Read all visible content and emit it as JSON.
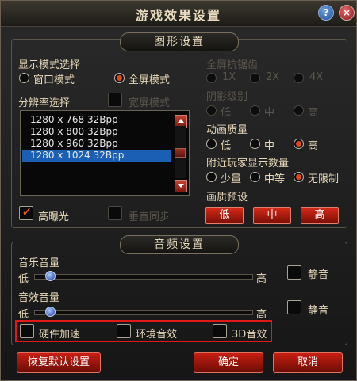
{
  "window": {
    "title": "游戏效果设置",
    "help_symbol": "?",
    "close_symbol": "×"
  },
  "graphics": {
    "header": "图形设置",
    "display_mode": {
      "label": "显示模式选择",
      "options": [
        "窗口模式",
        "全屏模式"
      ],
      "selected": "全屏模式"
    },
    "resolution": {
      "label": "分辨率选择",
      "widescreen_label": "宽屏模式",
      "items": [
        "1280 x 768 32Bpp",
        "1280 x 800 32Bpp",
        "1280 x 960 32Bpp",
        "1280 x 1024 32Bpp"
      ],
      "selected": "1280 x 1024 32Bpp"
    },
    "bloom_label": "高曝光",
    "vsync_label": "垂直同步",
    "antialias": {
      "label": "全屏抗锯齿",
      "options": [
        "1X",
        "2X",
        "4X"
      ]
    },
    "shadow": {
      "label": "阴影级别",
      "options": [
        "低",
        "中",
        "高"
      ]
    },
    "animation": {
      "label": "动画质量",
      "options": [
        "低",
        "中",
        "高"
      ],
      "selected": "高"
    },
    "players": {
      "label": "附近玩家显示数量",
      "options": [
        "少量",
        "中等",
        "无限制"
      ],
      "selected": "无限制"
    },
    "preset": {
      "label": "画质预设",
      "buttons": [
        "低",
        "中",
        "高"
      ]
    }
  },
  "audio": {
    "header": "音频设置",
    "music": {
      "label": "音乐音量",
      "min_label": "低",
      "max_label": "高",
      "mute_label": "静音",
      "level": 0.05
    },
    "sfx": {
      "label": "音效音量",
      "min_label": "低",
      "max_label": "高",
      "mute_label": "静音",
      "level": 0.05
    },
    "options": [
      "硬件加速",
      "环境音效",
      "3D音效"
    ]
  },
  "footer": {
    "reset": "恢复默认设置",
    "ok": "确定",
    "cancel": "取消"
  },
  "colors": {
    "accent_red": "#d82a1a",
    "selection_blue": "#1a5fb4",
    "highlight_box": "#e01818"
  }
}
